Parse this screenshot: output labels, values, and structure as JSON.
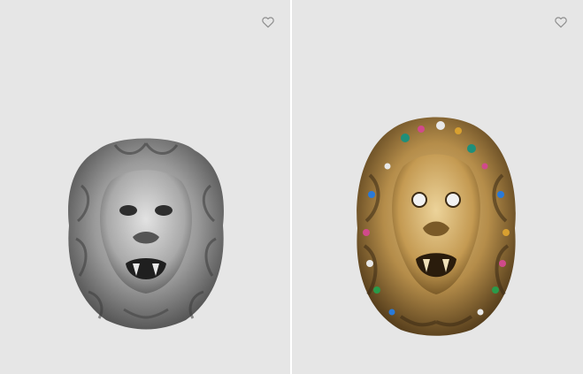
{
  "products": [
    {
      "image_alt": "",
      "wishlist_icon": "heart-outline-icon",
      "material": "silver",
      "colors": {
        "base": "#9a9a9a",
        "light": "#d0d0d0",
        "dark": "#3c3c3c"
      }
    },
    {
      "image_alt": "",
      "wishlist_icon": "heart-outline-icon",
      "material": "gold-with-crystals",
      "colors": {
        "base": "#b58d4a",
        "light": "#e0c48a",
        "dark": "#3b2a14"
      }
    }
  ],
  "colors": {
    "tile_bg": "#e6e6e6",
    "icon_stroke": "#8f8f8f",
    "page_bg": "#ffffff"
  }
}
